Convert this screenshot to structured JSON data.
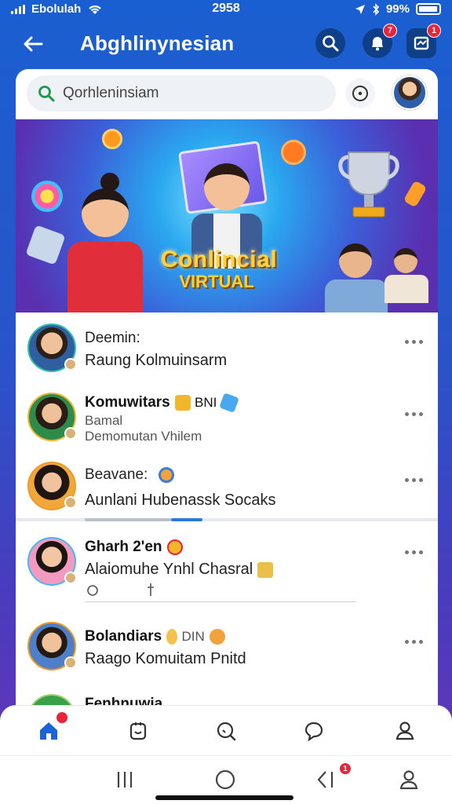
{
  "status_bar": {
    "carrier": "Ebolulah",
    "time": "2958",
    "battery": "99%"
  },
  "header": {
    "title": "Abghlinynesian",
    "notification_count": "7",
    "message_count": "1"
  },
  "search": {
    "placeholder": "Qorhleninsiam"
  },
  "banner": {
    "title_line1": "Conlincial",
    "title_line2": "VIRTUAL"
  },
  "feed": [
    {
      "name": "Deemin:",
      "line2": "Raung Kolmuinsarm",
      "line3": ""
    },
    {
      "name": "Komuwitars",
      "tag": "BNI",
      "line2": "Bamal",
      "line3": "Demomutan Vhilem"
    },
    {
      "name": "Beavane:",
      "line2": "Aunlani Hubenassk Socaks",
      "line3": ""
    },
    {
      "name": "Gharh 2'en",
      "line2": "Alaiomuhe Ynhl Chasral",
      "line3": ""
    },
    {
      "name": "Bolandiars",
      "tag": "DIN",
      "line2": "Raago Komuitam Pnitd",
      "line3": ""
    },
    {
      "name": "Fenhnuwia",
      "line2": "",
      "line3": ""
    }
  ],
  "bottom_nav": {
    "items": [
      "home",
      "feed",
      "search",
      "chat",
      "profile"
    ],
    "home_badge": true
  },
  "system_nav": {
    "badge": "1"
  },
  "colors": {
    "primary_blue": "#1a5fd1",
    "badge_red": "#e8233a",
    "accent_blue": "#2b7ad8"
  }
}
